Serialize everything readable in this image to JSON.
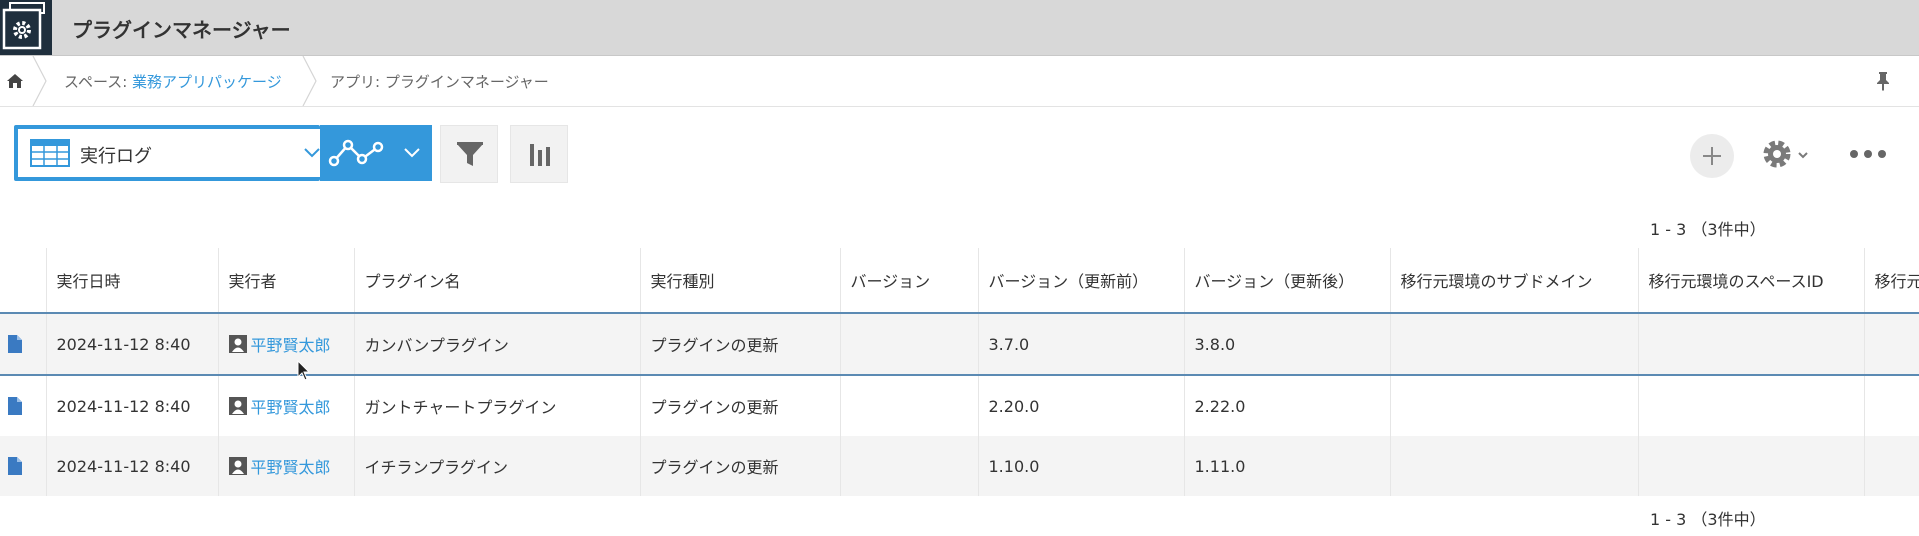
{
  "header": {
    "app_title": "プラグインマネージャー",
    "background": "#d8d8d8",
    "icon_bg": "#1f2f3d"
  },
  "breadcrumb": {
    "home_icon": "home-icon",
    "space_prefix": "スペース:",
    "space_name": "業務アプリパッケージ",
    "app_crumb": "アプリ: プラグインマネージャー",
    "pin_icon": "pin-icon"
  },
  "toolbar": {
    "view_name": "実行ログ",
    "view_icon": "table-icon",
    "graph_icon": "line-graph-icon",
    "filter_icon": "filter-icon",
    "chart_icon": "bar-chart-icon",
    "accent": "#3498db"
  },
  "actions": {
    "add_icon": "plus-icon",
    "settings_icon": "gear-icon",
    "more_icon": "more-icon"
  },
  "pager": {
    "top": "1 - 3 （3件中）",
    "bottom": "1 - 3 （3件中）"
  },
  "table": {
    "columns": [
      "",
      "実行日時",
      "実行者",
      "プラグイン名",
      "実行種別",
      "バージョン",
      "バージョン（更新前）",
      "バージョン（更新後）",
      "移行元環境のサブドメイン",
      "移行元環境のスペースID",
      "移行元"
    ],
    "rows": [
      {
        "datetime": "2024-11-12 8:40",
        "user": "平野賢太郎",
        "plugin": "カンバンプラグイン",
        "type": "プラグインの更新",
        "version": "",
        "version_before": "3.7.0",
        "version_after": "3.8.0",
        "subdomain": "",
        "space_id": "",
        "source": ""
      },
      {
        "datetime": "2024-11-12 8:40",
        "user": "平野賢太郎",
        "plugin": "ガントチャートプラグイン",
        "type": "プラグインの更新",
        "version": "",
        "version_before": "2.20.0",
        "version_after": "2.22.0",
        "subdomain": "",
        "space_id": "",
        "source": ""
      },
      {
        "datetime": "2024-11-12 8:40",
        "user": "平野賢太郎",
        "plugin": "イチランプラグイン",
        "type": "プラグインの更新",
        "version": "",
        "version_before": "1.10.0",
        "version_after": "1.11.0",
        "subdomain": "",
        "space_id": "",
        "source": ""
      }
    ]
  }
}
